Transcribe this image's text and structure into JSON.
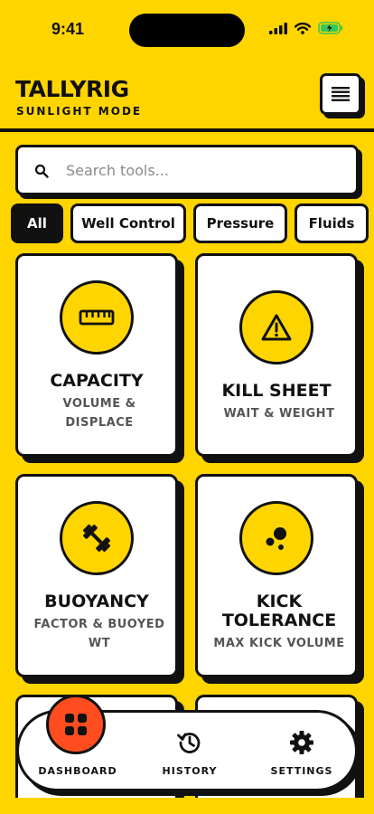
{
  "status": {
    "time": "9:41"
  },
  "header": {
    "brand": "TALLYRIG",
    "subtitle": "SUNLIGHT MODE",
    "menu_icon": "hamburger-icon"
  },
  "search": {
    "placeholder": "Search tools...",
    "value": ""
  },
  "filters": [
    {
      "label": "All",
      "active": true
    },
    {
      "label": "Well Control",
      "active": false
    },
    {
      "label": "Pressure",
      "active": false
    },
    {
      "label": "Fluids",
      "active": false
    }
  ],
  "cards": [
    {
      "title": "CAPACITY",
      "desc": "VOLUME & DISPLACE",
      "icon": "ruler-icon"
    },
    {
      "title": "KILL SHEET",
      "desc": "WAIT & WEIGHT",
      "icon": "warning-icon"
    },
    {
      "title": "BUOYANCY",
      "desc": "FACTOR & BUOYED WT",
      "icon": "dumbbell-icon"
    },
    {
      "title": "KICK TOLERANCE",
      "desc": "MAX KICK VOLUME",
      "icon": "bubbles-icon"
    }
  ],
  "nav": [
    {
      "label": "DASHBOARD",
      "icon": "grid-icon",
      "active": true
    },
    {
      "label": "HISTORY",
      "icon": "history-icon",
      "active": false
    },
    {
      "label": "SETTINGS",
      "icon": "gear-icon",
      "active": false
    }
  ],
  "colors": {
    "background": "#FFD500",
    "accent": "#FF4D1F",
    "ink": "#111111",
    "battery": "#34C759"
  }
}
